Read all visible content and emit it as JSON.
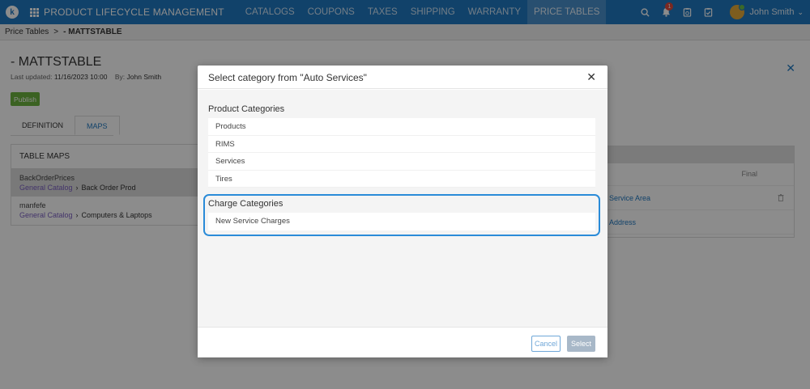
{
  "nav": {
    "logo_letter": "k",
    "app_title": "PRODUCT LIFECYCLE MANAGEMENT",
    "items": [
      "CATALOGS",
      "COUPONS",
      "TAXES",
      "SHIPPING",
      "WARRANTY",
      "PRICE TABLES"
    ],
    "active_item": "PRICE TABLES",
    "notification_count": "1",
    "user_name": "John Smith"
  },
  "breadcrumb": {
    "parent": "Price Tables",
    "separator": ">",
    "current": "- MATTSTABLE"
  },
  "page": {
    "title": "- MATTSTABLE",
    "last_updated_label": "Last updated:",
    "last_updated_value": "11/16/2023 10:00",
    "by_label": "By:",
    "by_value": "John Smith",
    "publish_label": "Publish",
    "tabs": [
      "DEFINITION",
      "MAPS"
    ],
    "active_tab": "MAPS"
  },
  "table_maps": {
    "header": "TABLE MAPS",
    "rows": [
      {
        "name": "BackOrderPrices",
        "catalog": "General Catalog",
        "leaf": "Back Order Prod"
      },
      {
        "name": "manfefe",
        "catalog": "General Catalog",
        "leaf": "Computers & Laptops"
      }
    ]
  },
  "right_panel": {
    "final_label": "Final",
    "rows": [
      "Service Area",
      "Address"
    ]
  },
  "modal": {
    "title": "Select category from \"Auto Services\"",
    "product_section_title": "Product Categories",
    "product_categories": [
      "Products",
      "RIMS",
      "Services",
      "Tires"
    ],
    "charge_section_title": "Charge Categories",
    "charge_categories": [
      "New Service Charges"
    ],
    "cancel_label": "Cancel",
    "select_label": "Select"
  },
  "colors": {
    "nav_bg": "#1f78c1",
    "accent": "#1f78c1",
    "publish": "#6cb33f",
    "highlight_border": "#2a8bd8",
    "catalog_link": "#7b5fc2"
  }
}
